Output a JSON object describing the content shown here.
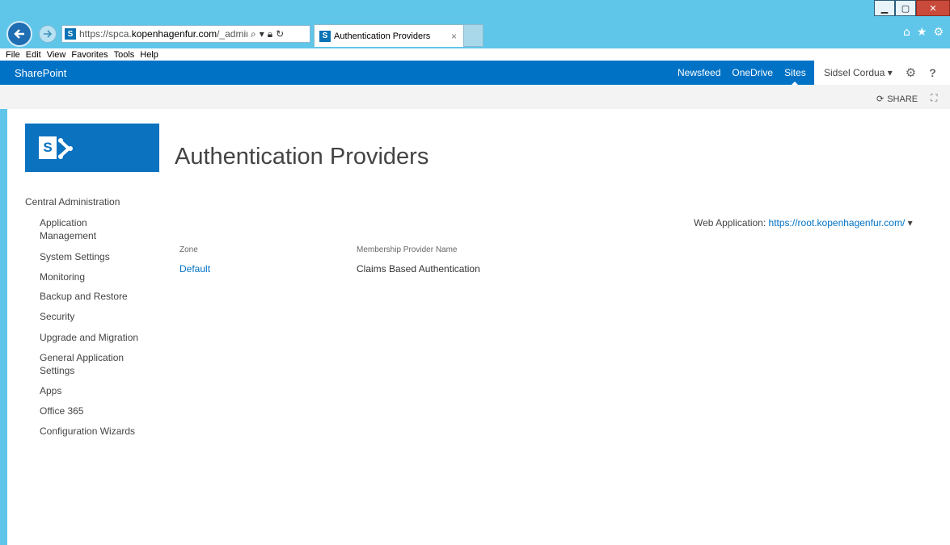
{
  "browser": {
    "address": {
      "prefix": "https://spca.",
      "domain": "kopenhagenfur.com",
      "suffix": "/_admin/au"
    },
    "tab_title": "Authentication Providers",
    "tab_close": "×",
    "menu": [
      "File",
      "Edit",
      "View",
      "Favorites",
      "Tools",
      "Help"
    ]
  },
  "suitebar": {
    "brand": "SharePoint",
    "links": [
      "Newsfeed",
      "OneDrive",
      "Sites"
    ],
    "active_link": "Sites",
    "user": "Sidsel Cordua ▾",
    "help": "?"
  },
  "ribbon": {
    "share": "SHARE"
  },
  "page": {
    "title": "Authentication Providers"
  },
  "quicklaunch": {
    "root": "Central Administration",
    "items": [
      "Application Management",
      "System Settings",
      "Monitoring",
      "Backup and Restore",
      "Security",
      "Upgrade and Migration",
      "General Application Settings",
      "Apps",
      "Office 365",
      "Configuration Wizards"
    ]
  },
  "webapp": {
    "label": "Web Application:",
    "value": "https://root.kopenhagenfur.com/",
    "caret": "▾"
  },
  "table": {
    "headers": [
      "Zone",
      "Membership Provider Name"
    ],
    "rows": [
      [
        "Default",
        "Claims Based Authentication"
      ]
    ]
  },
  "colors": {
    "ie_chrome": "#5fc6ea",
    "suitebar": "#0072c6",
    "link": "#0072c6"
  }
}
